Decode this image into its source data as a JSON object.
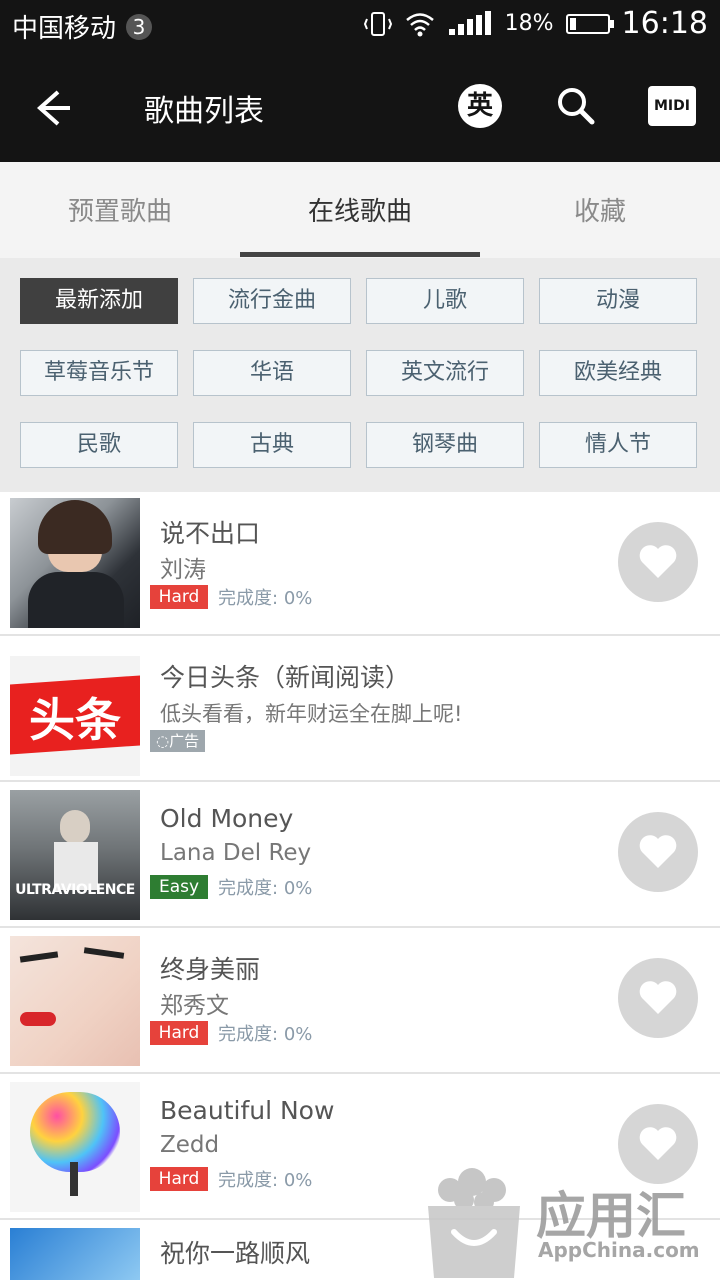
{
  "status_bar": {
    "carrier": "中国移动",
    "sim_slot": "3",
    "battery_pct": "18%",
    "battery_level": 0.18,
    "time": "16:18"
  },
  "appbar": {
    "title": "歌曲列表",
    "lang_label": "英",
    "midi_label": "MIDI"
  },
  "tabs": [
    {
      "label": "预置歌曲",
      "active": false
    },
    {
      "label": "在线歌曲",
      "active": true
    },
    {
      "label": "收藏",
      "active": false
    }
  ],
  "categories": [
    {
      "label": "最新添加",
      "active": true
    },
    {
      "label": "流行金曲"
    },
    {
      "label": "儿歌"
    },
    {
      "label": "动漫"
    },
    {
      "label": "草莓音乐节"
    },
    {
      "label": "华语"
    },
    {
      "label": "英文流行"
    },
    {
      "label": "欧美经典"
    },
    {
      "label": "民歌"
    },
    {
      "label": "古典"
    },
    {
      "label": "钢琴曲"
    },
    {
      "label": "情人节"
    }
  ],
  "songs": [
    {
      "title": "说不出口",
      "artist": "刘涛",
      "difficulty": "Hard",
      "progress_label": "完成度:",
      "progress": "0%"
    },
    {
      "title": "今日头条（新闻阅读）",
      "subtitle": "低头看看，新年财运全在脚上呢!",
      "ad_label": "广告",
      "logo_text": "头条"
    },
    {
      "title": "Old Money",
      "artist": "Lana Del Rey",
      "difficulty": "Easy",
      "progress_label": "完成度:",
      "progress": "0%",
      "cover_text": "ULTRAVIOLENCE"
    },
    {
      "title": "终身美丽",
      "artist": "郑秀文",
      "difficulty": "Hard",
      "progress_label": "完成度:",
      "progress": "0%"
    },
    {
      "title": "Beautiful Now",
      "artist": "Zedd",
      "difficulty": "Hard",
      "progress_label": "完成度:",
      "progress": "0%"
    },
    {
      "title": "祝你一路顺风"
    }
  ],
  "watermark": {
    "name": "应用汇",
    "domain": "AppChina.com"
  },
  "colors": {
    "bar": "#141414",
    "hard": "#e6423b",
    "easy": "#2e7d32",
    "active_category": "#404040"
  }
}
